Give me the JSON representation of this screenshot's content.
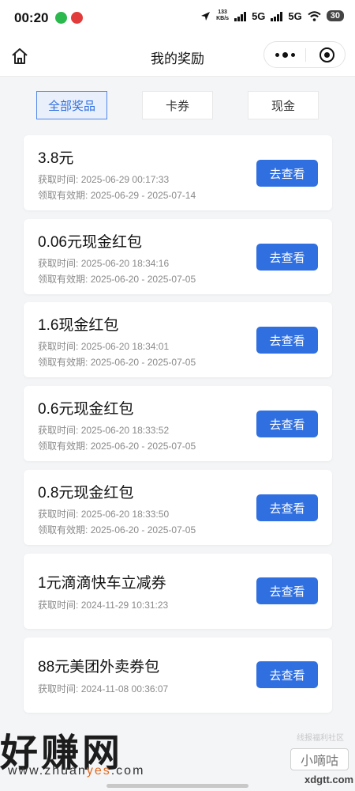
{
  "status_bar": {
    "time": "00:20",
    "net_speed_value": "133",
    "net_speed_unit": "KB/s",
    "signal_1": "5G",
    "signal_2": "5G",
    "battery": "30"
  },
  "nav": {
    "title": "我的奖励"
  },
  "tabs": [
    {
      "label": "全部奖品",
      "active": true
    },
    {
      "label": "卡券",
      "active": false
    },
    {
      "label": "现金",
      "active": false
    }
  ],
  "rewards": [
    {
      "title": "3.8元",
      "acquired_label": "获取时间:",
      "acquired": "2025-06-29 00:17:33",
      "validity_label": "领取有效期:",
      "validity": "2025-06-29 - 2025-07-14",
      "button": "去查看"
    },
    {
      "title": "0.06元现金红包",
      "acquired_label": "获取时间:",
      "acquired": "2025-06-20 18:34:16",
      "validity_label": "领取有效期:",
      "validity": "2025-06-20 - 2025-07-05",
      "button": "去查看"
    },
    {
      "title": "1.6现金红包",
      "acquired_label": "获取时间:",
      "acquired": "2025-06-20 18:34:01",
      "validity_label": "领取有效期:",
      "validity": "2025-06-20 - 2025-07-05",
      "button": "去查看"
    },
    {
      "title": "0.6元现金红包",
      "acquired_label": "获取时间:",
      "acquired": "2025-06-20 18:33:52",
      "validity_label": "领取有效期:",
      "validity": "2025-06-20 - 2025-07-05",
      "button": "去查看"
    },
    {
      "title": "0.8元现金红包",
      "acquired_label": "获取时间:",
      "acquired": "2025-06-20 18:33:50",
      "validity_label": "领取有效期:",
      "validity": "2025-06-20 - 2025-07-05",
      "button": "去查看"
    },
    {
      "title": "1元滴滴快车立减券",
      "acquired_label": "获取时间:",
      "acquired": "2024-11-29 10:31:23",
      "button": "去查看"
    },
    {
      "title": "88元美团外卖券包",
      "acquired_label": "获取时间:",
      "acquired": "2024-11-08 00:36:07",
      "button": "去查看"
    }
  ],
  "watermarks": {
    "site_name": "好赚网",
    "site_url_pre": "www.zhuan",
    "site_url_accent": "yes",
    "site_url_post": ".com",
    "community_text": "线报福利社区",
    "box_text": "小嘀咕",
    "domain": "xdgtt.com"
  },
  "colors": {
    "accent": "#2f6fe0",
    "tab_active_bg": "#eaf0fb",
    "background": "#f4f5f7"
  }
}
